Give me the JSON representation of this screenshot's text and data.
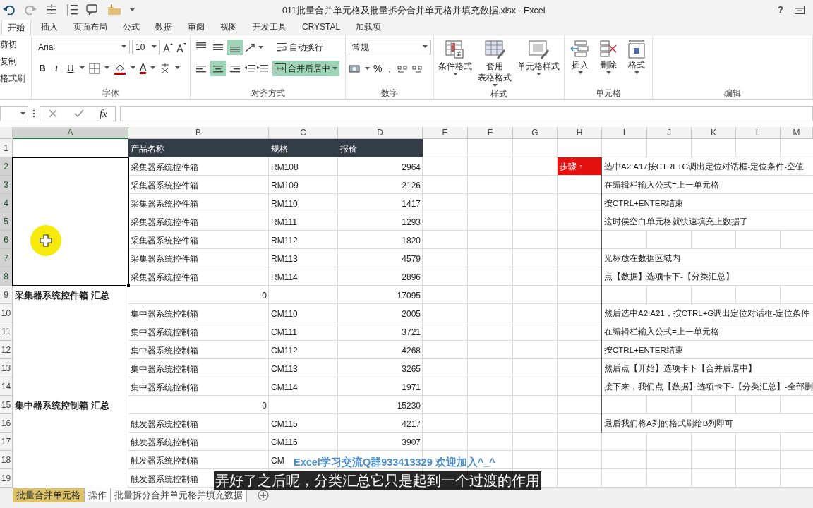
{
  "window": {
    "title": "011批量合并单元格及批量拆分合并单元格并填充数据.xlsx - Excel",
    "help": "?"
  },
  "menu_tabs": [
    {
      "label": "开始",
      "selected": true
    },
    {
      "label": "插入",
      "selected": false
    },
    {
      "label": "页面布局",
      "selected": false
    },
    {
      "label": "公式",
      "selected": false
    },
    {
      "label": "数据",
      "selected": false
    },
    {
      "label": "审阅",
      "selected": false
    },
    {
      "label": "视图",
      "selected": false
    },
    {
      "label": "开发工具",
      "selected": false
    },
    {
      "label": "CRYSTAL",
      "selected": false
    },
    {
      "label": "加载项",
      "selected": false
    }
  ],
  "ribbon": {
    "clipboard": {
      "items": [
        "剪切",
        "复制",
        "格式刷"
      ]
    },
    "font": {
      "label": "字体",
      "font_name": "Arial",
      "font_size": "10",
      "styles": [
        "B",
        "I",
        "U"
      ],
      "font_color_letter": "A"
    },
    "alignment": {
      "label": "对齐方式",
      "vertical": [
        {
          "selected": false
        },
        {
          "selected": false
        },
        {
          "selected": true
        }
      ],
      "horizontal": [
        {
          "selected": false
        },
        {
          "selected": true
        },
        {
          "selected": false
        }
      ],
      "wrap_text": "自动换行",
      "merge": {
        "label": "合并后居中",
        "selected": true
      }
    },
    "number": {
      "label": "数字",
      "format": "常规",
      "symbols": [
        "%",
        ","
      ]
    },
    "styles": {
      "label": "样式",
      "buttons": [
        {
          "kind": "conditional",
          "lines": [
            "条件格式"
          ]
        },
        {
          "kind": "table",
          "lines": [
            "套用",
            "表格格式"
          ]
        },
        {
          "kind": "cellstyle",
          "lines": [
            "单元格样式"
          ]
        }
      ]
    },
    "cells": {
      "label": "单元格",
      "buttons": [
        {
          "kind": "insert",
          "label": "插入"
        },
        {
          "kind": "delete",
          "label": "删除"
        },
        {
          "kind": "format",
          "label": "格式"
        }
      ]
    },
    "editing": {
      "label": "编辑"
    }
  },
  "formula_bar": {
    "fx": "fx"
  },
  "columns": [
    {
      "label": "A",
      "selected": true
    },
    {
      "label": "B",
      "selected": false
    },
    {
      "label": "C",
      "selected": false
    },
    {
      "label": "D",
      "selected": false
    },
    {
      "label": "E",
      "selected": false
    },
    {
      "label": "F",
      "selected": false
    },
    {
      "label": "G",
      "selected": false
    },
    {
      "label": "H",
      "selected": false
    },
    {
      "label": "I",
      "selected": false
    },
    {
      "label": "J",
      "selected": false
    },
    {
      "label": "K",
      "selected": false
    },
    {
      "label": "L",
      "selected": false
    },
    {
      "label": "M",
      "selected": false
    }
  ],
  "rows": [
    {
      "number": "1",
      "selected": false,
      "cells": {
        "B": {
          "kind": "header",
          "text": "产品名称"
        },
        "C": {
          "kind": "header",
          "text": "规格"
        },
        "D": {
          "kind": "header",
          "text": "报价"
        }
      }
    },
    {
      "number": "2",
      "selected": true,
      "cells": {
        "B": {
          "kind": "text",
          "text": "采集器系统控件箱"
        },
        "C": {
          "kind": "text",
          "text": "RM108"
        },
        "D": {
          "kind": "number",
          "text": "2964"
        },
        "H": {
          "kind": "step",
          "text": "步骤："
        },
        "I": {
          "kind": "note",
          "text": "选中A2:A17按CTRL+G调出定位对话框-定位条件-空值"
        }
      }
    },
    {
      "number": "3",
      "selected": true,
      "cells": {
        "B": {
          "kind": "text",
          "text": "采集器系统控件箱"
        },
        "C": {
          "kind": "text",
          "text": "RM109"
        },
        "D": {
          "kind": "number",
          "text": "2126"
        },
        "I": {
          "kind": "note",
          "text": "在编辑栏输入公式=上一单元格"
        }
      }
    },
    {
      "number": "4",
      "selected": true,
      "cells": {
        "B": {
          "kind": "text",
          "text": "采集器系统控件箱"
        },
        "C": {
          "kind": "text",
          "text": "RM110"
        },
        "D": {
          "kind": "number",
          "text": "1417"
        },
        "I": {
          "kind": "note",
          "text": "按CTRL+ENTER结束"
        }
      }
    },
    {
      "number": "5",
      "selected": true,
      "cells": {
        "B": {
          "kind": "text",
          "text": "采集器系统控件箱"
        },
        "C": {
          "kind": "text",
          "text": "RM111"
        },
        "D": {
          "kind": "number",
          "text": "1293"
        },
        "I": {
          "kind": "note",
          "text": "这时侯空白单元格就快速填充上数据了"
        }
      }
    },
    {
      "number": "6",
      "selected": true,
      "cells": {
        "B": {
          "kind": "text",
          "text": "采集器系统控件箱"
        },
        "C": {
          "kind": "text",
          "text": "RM112"
        },
        "D": {
          "kind": "number",
          "text": "1820"
        }
      }
    },
    {
      "number": "7",
      "selected": true,
      "cells": {
        "B": {
          "kind": "text",
          "text": "采集器系统控件箱"
        },
        "C": {
          "kind": "text",
          "text": "RM113"
        },
        "D": {
          "kind": "number",
          "text": "4579"
        },
        "I": {
          "kind": "note",
          "text": "光标放在数据区域内"
        }
      }
    },
    {
      "number": "8",
      "selected": true,
      "cells": {
        "B": {
          "kind": "text",
          "text": "采集器系统控件箱"
        },
        "C": {
          "kind": "text",
          "text": "RM114"
        },
        "D": {
          "kind": "number",
          "text": "2896"
        },
        "I": {
          "kind": "note",
          "text": "点【数据】选项卡下-【分类汇总】"
        }
      }
    },
    {
      "number": "9",
      "selected": false,
      "cells": {
        "A": {
          "kind": "subtotal",
          "text": "采集器系统控件箱 汇总"
        },
        "B": {
          "kind": "number",
          "text": "0"
        },
        "D": {
          "kind": "number",
          "text": "17095"
        }
      }
    },
    {
      "number": "10",
      "selected": false,
      "cells": {
        "B": {
          "kind": "text",
          "text": "集中器系统控制箱"
        },
        "C": {
          "kind": "text",
          "text": "CM110"
        },
        "D": {
          "kind": "number",
          "text": "2005"
        },
        "I": {
          "kind": "note",
          "text": "然后选中A2:A21，按CTRL+G调出定位对话框-定位条件"
        }
      }
    },
    {
      "number": "11",
      "selected": false,
      "cells": {
        "B": {
          "kind": "text",
          "text": "集中器系统控制箱"
        },
        "C": {
          "kind": "text",
          "text": "CM111"
        },
        "D": {
          "kind": "number",
          "text": "3721"
        },
        "I": {
          "kind": "note",
          "text": "在编辑栏输入公式=上一单元格"
        }
      }
    },
    {
      "number": "12",
      "selected": false,
      "cells": {
        "B": {
          "kind": "text",
          "text": "集中器系统控制箱"
        },
        "C": {
          "kind": "text",
          "text": "CM112"
        },
        "D": {
          "kind": "number",
          "text": "4268"
        },
        "I": {
          "kind": "note",
          "text": "按CTRL+ENTER结束"
        }
      }
    },
    {
      "number": "13",
      "selected": false,
      "cells": {
        "B": {
          "kind": "text",
          "text": "集中器系统控制箱"
        },
        "C": {
          "kind": "text",
          "text": "CM113"
        },
        "D": {
          "kind": "number",
          "text": "3265"
        },
        "I": {
          "kind": "note",
          "text": "然后点【开始】选项卡下【合并后居中】"
        }
      }
    },
    {
      "number": "14",
      "selected": false,
      "cells": {
        "B": {
          "kind": "text",
          "text": "集中器系统控制箱"
        },
        "C": {
          "kind": "text",
          "text": "CM114"
        },
        "D": {
          "kind": "number",
          "text": "1971"
        },
        "I": {
          "kind": "note",
          "text": "接下来，我们点【数据】选项卡下-【分类汇总】-全部删"
        }
      }
    },
    {
      "number": "15",
      "selected": false,
      "cells": {
        "A": {
          "kind": "subtotal",
          "text": "集中器系统控制箱 汇总"
        },
        "B": {
          "kind": "number",
          "text": "0"
        },
        "D": {
          "kind": "number",
          "text": "15230"
        }
      }
    },
    {
      "number": "16",
      "selected": false,
      "cells": {
        "B": {
          "kind": "text",
          "text": "触发器系统控制箱"
        },
        "C": {
          "kind": "text",
          "text": "CM115"
        },
        "D": {
          "kind": "number",
          "text": "4217"
        },
        "I": {
          "kind": "note",
          "text": "最后我们将A列的格式刷给B列即可"
        }
      }
    },
    {
      "number": "17",
      "selected": false,
      "cells": {
        "B": {
          "kind": "text",
          "text": "触发器系统控制箱"
        },
        "C": {
          "kind": "text",
          "text": "CM116"
        },
        "D": {
          "kind": "number",
          "text": "3907"
        }
      }
    },
    {
      "number": "18",
      "selected": false,
      "cells": {
        "B": {
          "kind": "text",
          "text": "触发器系统控制箱"
        },
        "C": {
          "kind": "text",
          "text": "CM"
        }
      }
    },
    {
      "number": "19",
      "selected": false,
      "cells": {
        "B": {
          "kind": "text",
          "text": "触发器系统控制箱"
        }
      }
    }
  ],
  "sheet_tabs": [
    {
      "label": "批量合并单元格",
      "selected": true
    },
    {
      "label": "操作",
      "selected": false
    },
    {
      "label": "批量拆分合并单元格并填充数据",
      "selected": false
    }
  ],
  "video_overlay": {
    "caption": "Excel学习交流Q群933413329 欢迎加入^_^",
    "subtitle": "弄好了之后呢，分类汇总它只是起到一个过渡的作用"
  }
}
